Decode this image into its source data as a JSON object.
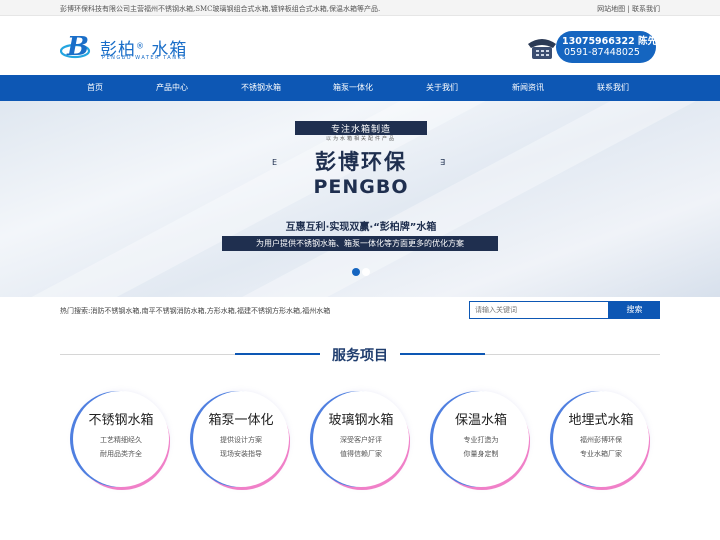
{
  "topbar": {
    "intro": "彭博环保科技有限公司主营福州不锈钢水箱,SMC玻璃钢组合式水箱,镀锌板组合式水箱,保温水箱等产品.",
    "sitemap_link": "网站地图",
    "separator": "|",
    "contact_link": "联系我们"
  },
  "logo": {
    "cn_name": "彭柏",
    "reg_mark": "®",
    "cn_suffix": "水箱",
    "en_name": "PENGBO WATER TANKS",
    "mark_letter": "B"
  },
  "contact": {
    "line1": "13075966322  陈先生",
    "line2": "0591-87448025"
  },
  "nav": {
    "items": [
      {
        "label": "首页"
      },
      {
        "label": "产品中心"
      },
      {
        "label": "不锈钢水箱"
      },
      {
        "label": "箱泵一体化"
      },
      {
        "label": "关于我们"
      },
      {
        "label": "新闻资讯"
      },
      {
        "label": "联系我们"
      }
    ]
  },
  "banner": {
    "ribbon": "专注水箱制造",
    "sub": "以为水箱相关配件产品",
    "title": "彭博环保",
    "deco_left": "E",
    "deco_right": "∃",
    "en_title": "PENGBO",
    "slogan": "互惠互利·实现双赢·“彭柏牌”水箱",
    "bar": "为用户提供不锈钢水箱、箱泵一体化等方面更多的优化方案",
    "slide_count": 2,
    "active_slide": 1
  },
  "search": {
    "hot_label": "热门搜索:",
    "hot_terms": "消防不锈钢水箱,南平不锈钢消防水箱,方形水箱,福建不锈钢方形水箱,福州水箱",
    "placeholder": "请输入关键词",
    "button": "搜索"
  },
  "services": {
    "title": "服务项目",
    "items": [
      {
        "title": "不锈钢水箱",
        "line1": "工艺精细经久",
        "line2": "耐用品类齐全"
      },
      {
        "title": "箱泵一体化",
        "line1": "提供设计方案",
        "line2": "现场安装指导"
      },
      {
        "title": "玻璃钢水箱",
        "line1": "深受客户好评",
        "line2": "值得信赖厂家"
      },
      {
        "title": "保温水箱",
        "line1": "专业打造为",
        "line2": "你量身定制"
      },
      {
        "title": "地埋式水箱",
        "line1": "福州彭博环保",
        "line2": "专业水箱厂家"
      }
    ]
  },
  "colors": {
    "brand_blue": "#0d57b4",
    "navy": "#1f2f4f",
    "accent_pink": "#f080c8",
    "accent_blue": "#4f7fe0"
  },
  "icons": {
    "logo": "b-letter-logo-icon",
    "phone": "telephone-icon"
  }
}
